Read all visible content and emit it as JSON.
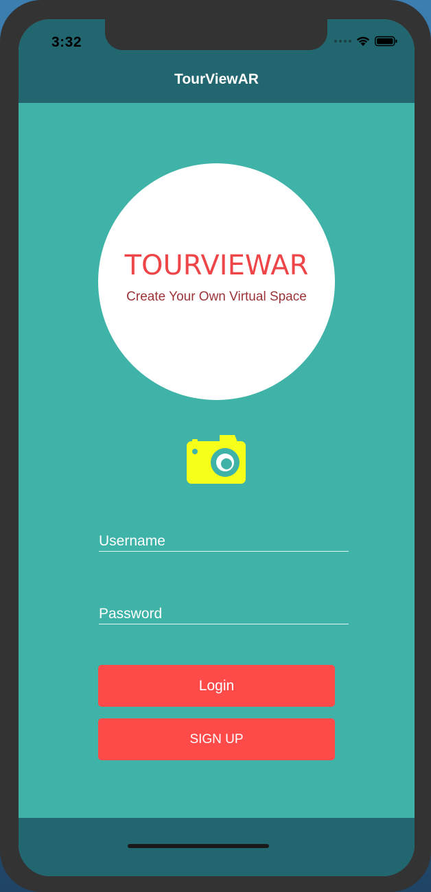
{
  "status_bar": {
    "time": "3:32"
  },
  "nav": {
    "title": "TourViewAR"
  },
  "logo": {
    "title": "TOURVIEWAR",
    "subtitle": "Create Your Own Virtual Space"
  },
  "form": {
    "username_placeholder": "Username",
    "password_placeholder": "Password"
  },
  "buttons": {
    "login_label": "Login",
    "signup_label": "SIGN UP"
  },
  "colors": {
    "nav_bar": "#226670",
    "background": "#3fb3a7",
    "button": "#ff4a4a",
    "camera_icon": "#f5ff1a",
    "logo_title": "#ee4548"
  },
  "icons": {
    "camera": "camera-icon",
    "wifi": "wifi-icon",
    "battery": "battery-icon",
    "signal": "signal-icon"
  }
}
